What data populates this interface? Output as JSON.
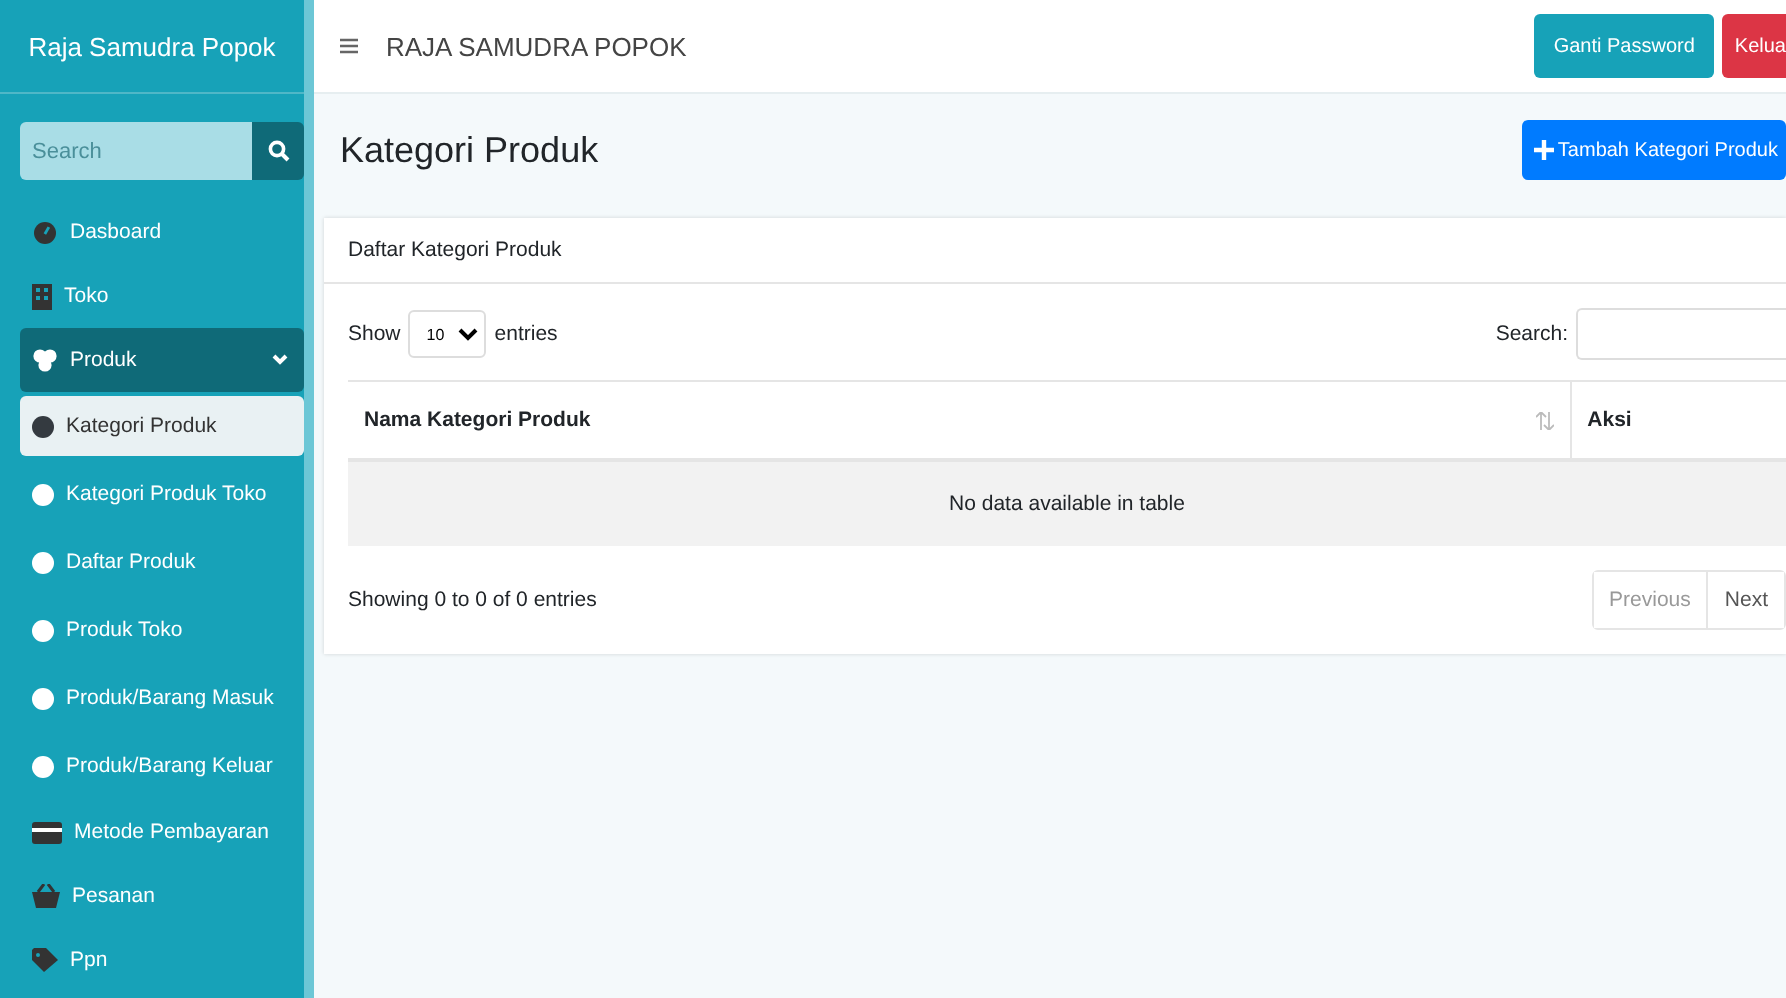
{
  "brand": "Raja Samudra Popok",
  "sidebar": {
    "search": {
      "placeholder": "Search"
    },
    "items": [
      {
        "label": "Dasboard",
        "kind": "link",
        "selected": false
      },
      {
        "label": "Toko",
        "kind": "link",
        "selected": false
      },
      {
        "label": "Produk",
        "kind": "group",
        "selected": true,
        "expanded": true,
        "children": [
          {
            "label": "Kategori Produk",
            "selected": true
          },
          {
            "label": "Kategori Produk Toko",
            "selected": false
          },
          {
            "label": "Daftar Produk",
            "selected": false
          },
          {
            "label": "Produk Toko",
            "selected": false
          },
          {
            "label": "Produk/Barang Masuk",
            "selected": false
          },
          {
            "label": "Produk/Barang Keluar",
            "selected": false
          }
        ]
      },
      {
        "label": "Metode Pembayaran",
        "kind": "link",
        "selected": false
      },
      {
        "label": "Pesanan",
        "kind": "link",
        "selected": false
      },
      {
        "label": "Ppn",
        "kind": "link",
        "selected": false
      }
    ]
  },
  "topbar": {
    "title": "RAJA SAMUDRA POPOK",
    "buttons": [
      {
        "label": "Ganti Password",
        "kind": "info"
      },
      {
        "label": "Kelua",
        "kind": "danger"
      }
    ]
  },
  "page": {
    "title": "Kategori Produk",
    "add_button": "Tambah Kategori Produk"
  },
  "card": {
    "title": "Daftar Kategori Produk",
    "length": {
      "before": "Show",
      "value": "10",
      "after": "entries"
    },
    "search_label": "Search:",
    "table": {
      "columns": [
        {
          "label": "Nama Kategori Produk",
          "sortable": true
        },
        {
          "label": "Aksi",
          "sortable": false
        }
      ],
      "empty": "No data available in table"
    },
    "info": "Showing 0 to 0 of 0 entries",
    "pager": [
      {
        "label": "Previous",
        "disabled": true
      },
      {
        "label": "Next",
        "disabled": false
      }
    ]
  }
}
